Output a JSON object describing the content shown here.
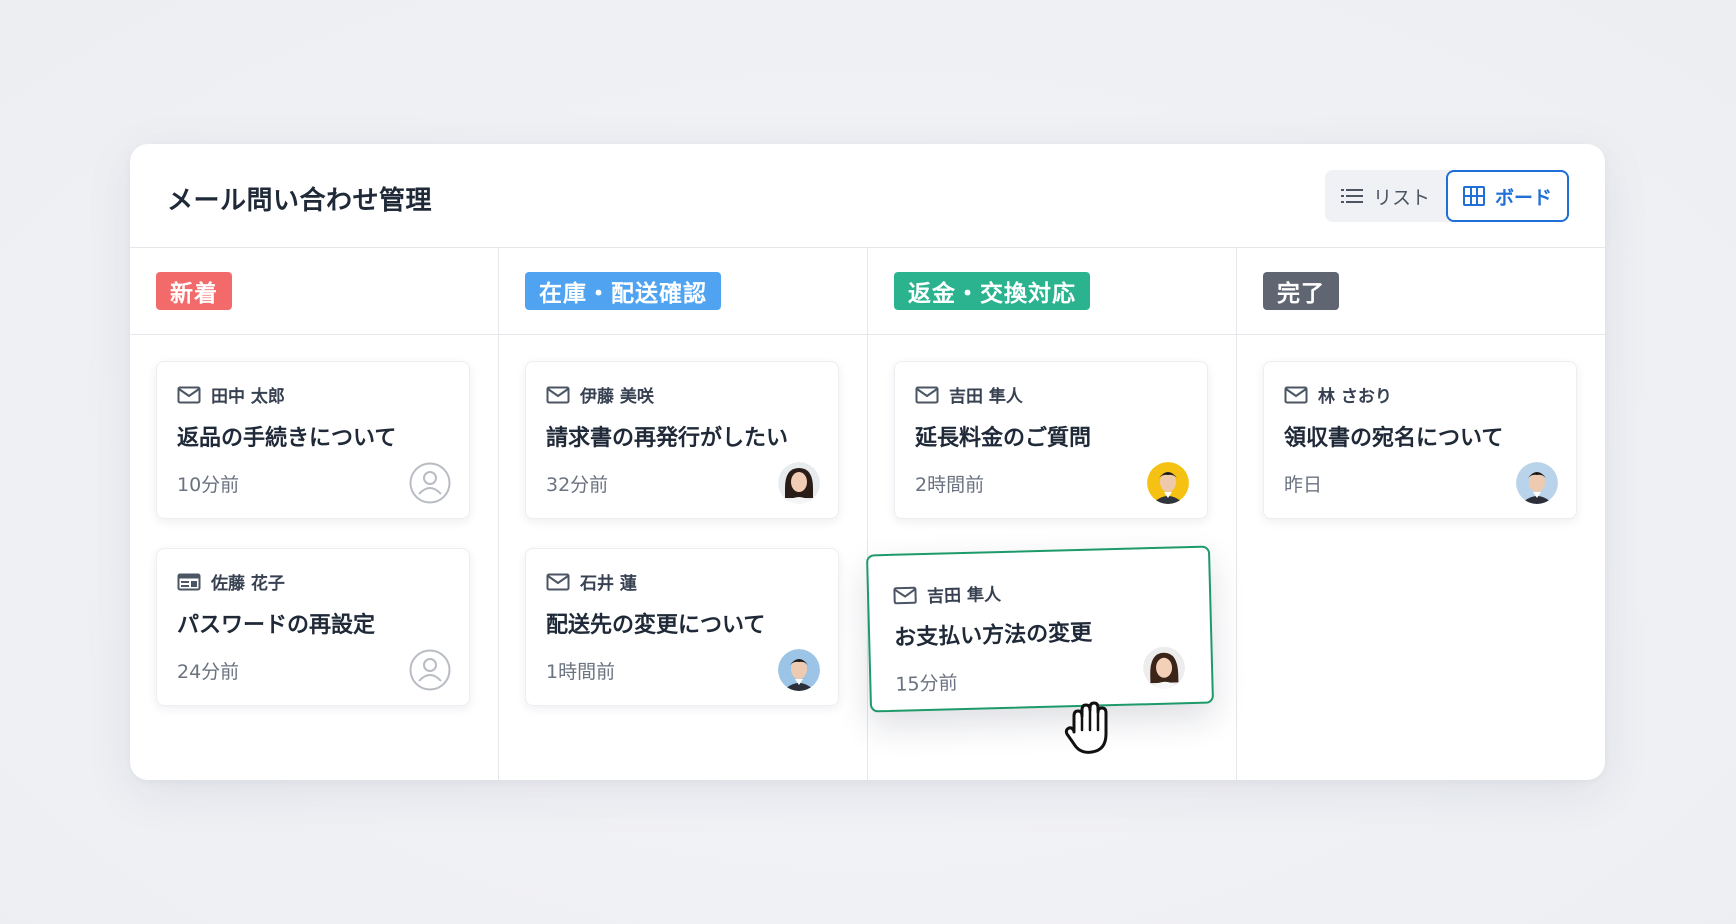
{
  "header": {
    "title": "メール問い合わせ管理",
    "view_toggle": {
      "list_label": "リスト",
      "board_label": "ボード",
      "selected": "board"
    }
  },
  "colors": {
    "accent": "#1f6fd6",
    "new": "#f26a6a",
    "stock": "#4fa3f0",
    "refund": "#2bb38f",
    "done": "#5f6672",
    "drag_border": "#1e9a6a"
  },
  "columns": [
    {
      "label": "新着",
      "cards": [
        {
          "icon": "mail-icon",
          "sender": "田中 太郎",
          "subject": "返品の手続きについて",
          "time": "10分前",
          "avatar": "default-user-icon"
        },
        {
          "icon": "form-icon",
          "sender": "佐藤 花子",
          "subject": "パスワードの再設定",
          "time": "24分前",
          "avatar": "default-user-icon"
        }
      ]
    },
    {
      "label": "在庫・配送確認",
      "cards": [
        {
          "icon": "mail-icon",
          "sender": "伊藤 美咲",
          "subject": "請求書の再発行がしたい",
          "time": "32分前",
          "avatar": "woman-photo-avatar"
        },
        {
          "icon": "mail-icon",
          "sender": "石井 蓮",
          "subject": "配送先の変更について",
          "time": "1時間前",
          "avatar": "man-photo-avatar"
        }
      ]
    },
    {
      "label": "返金・交換対応",
      "cards": [
        {
          "icon": "mail-icon",
          "sender": "吉田 隼人",
          "subject": "延長料金のご質問",
          "time": "2時間前",
          "avatar": "man-photo-avatar-yellow"
        }
      ]
    },
    {
      "label": "完了",
      "cards": [
        {
          "icon": "mail-icon",
          "sender": "林 さおり",
          "subject": "領収書の宛名について",
          "time": "昨日",
          "avatar": "man-photo-avatar"
        }
      ]
    }
  ],
  "dragging_card": {
    "icon": "mail-icon",
    "sender": "吉田 隼人",
    "subject": "お支払い方法の変更",
    "time": "15分前",
    "avatar": "woman-photo-avatar-2"
  }
}
